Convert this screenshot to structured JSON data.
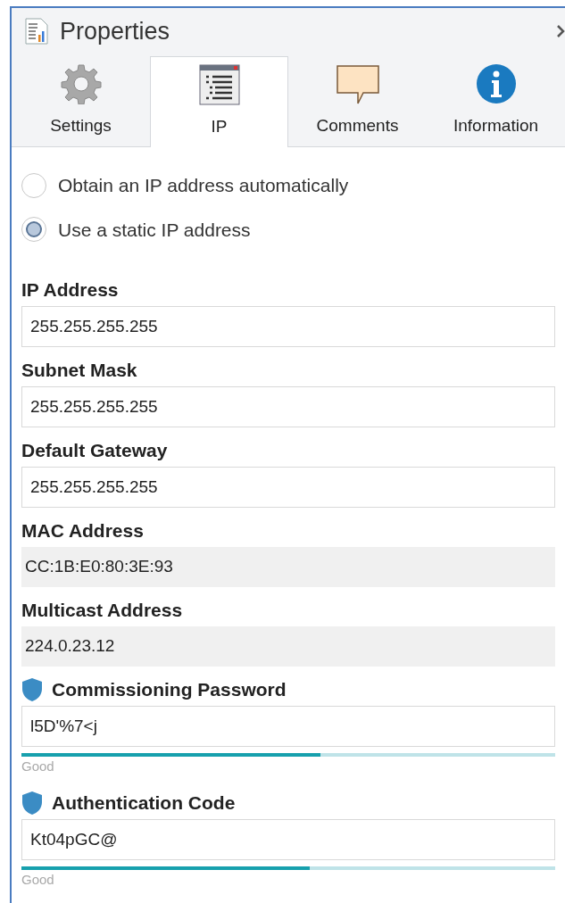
{
  "panel": {
    "title": "Properties"
  },
  "tabs": [
    {
      "label": "Settings",
      "kind": "gear",
      "selected": false
    },
    {
      "label": "IP",
      "kind": "list",
      "selected": true
    },
    {
      "label": "Comments",
      "kind": "comment",
      "selected": false
    },
    {
      "label": "Information",
      "kind": "info",
      "selected": false
    }
  ],
  "ip_mode": [
    {
      "label": "Obtain an IP address automatically",
      "selected": false
    },
    {
      "label": "Use a static IP address",
      "selected": true
    }
  ],
  "fields": [
    {
      "label": "IP Address",
      "value": "255.255.255.255",
      "kind": "input"
    },
    {
      "label": "Subnet Mask",
      "value": "255.255.255.255",
      "kind": "input"
    },
    {
      "label": "Default Gateway",
      "value": "255.255.255.255",
      "kind": "input"
    },
    {
      "label": "MAC Address",
      "value": "CC:1B:E0:80:3E:93",
      "kind": "readonly"
    },
    {
      "label": "Multicast Address",
      "value": "224.0.23.12",
      "kind": "readonly"
    },
    {
      "label": "Commissioning Password",
      "value": "l5D'%7<j",
      "kind": "secret",
      "level": 0.56,
      "strength": "Good"
    },
    {
      "label": "Authentication Code",
      "value": "Kt04pGC@",
      "kind": "secret",
      "level": 0.54,
      "strength": "Good"
    }
  ]
}
